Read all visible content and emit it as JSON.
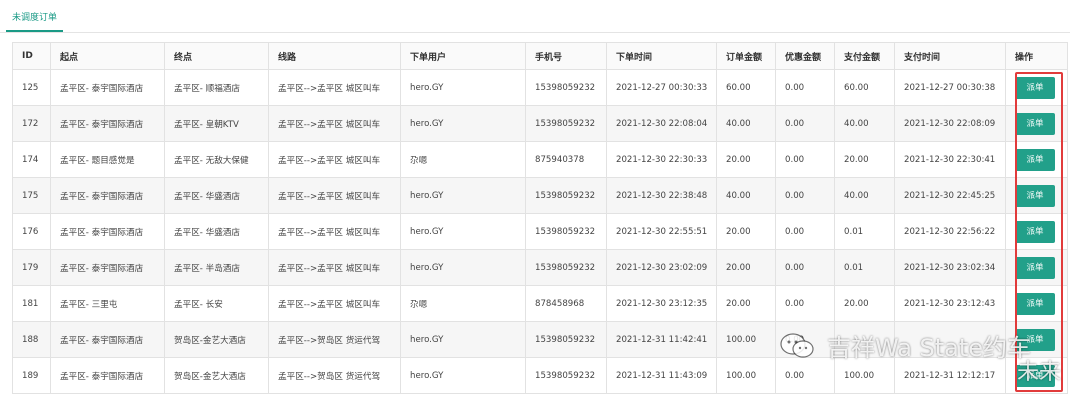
{
  "tabs": [
    {
      "label": "未调度订单"
    }
  ],
  "table": {
    "columns": [
      "ID",
      "起点",
      "终点",
      "线路",
      "下单用户",
      "手机号",
      "下单时间",
      "订单金额",
      "优惠金额",
      "支付金额",
      "支付时间",
      "操作"
    ],
    "rows": [
      {
        "id": "125",
        "start": "孟平区- 泰宇国际酒店",
        "end": "孟平区- 顺福酒店",
        "route": "孟平区-->孟平区 城区叫车",
        "user": "hero.GY",
        "phone": "15398059232",
        "order_time": "2021-12-27 00:30:33",
        "amount": "60.00",
        "discount": "0.00",
        "paid": "60.00",
        "pay_time": "2021-12-27 00:30:38",
        "action": "派单"
      },
      {
        "id": "172",
        "start": "孟平区- 泰宇国际酒店",
        "end": "孟平区- 皇朝KTV",
        "route": "孟平区-->孟平区 城区叫车",
        "user": "hero.GY",
        "phone": "15398059232",
        "order_time": "2021-12-30 22:08:04",
        "amount": "40.00",
        "discount": "0.00",
        "paid": "40.00",
        "pay_time": "2021-12-30 22:08:09",
        "action": "派单"
      },
      {
        "id": "174",
        "start": "孟平区- 题目感觉是",
        "end": "孟平区- 无敌大保健",
        "route": "孟平区-->孟平区 城区叫车",
        "user": "尕嗯",
        "phone": "875940378",
        "order_time": "2021-12-30 22:30:33",
        "amount": "20.00",
        "discount": "0.00",
        "paid": "20.00",
        "pay_time": "2021-12-30 22:30:41",
        "action": "派单"
      },
      {
        "id": "175",
        "start": "孟平区- 泰宇国际酒店",
        "end": "孟平区- 华盛酒店",
        "route": "孟平区-->孟平区 城区叫车",
        "user": "hero.GY",
        "phone": "15398059232",
        "order_time": "2021-12-30 22:38:48",
        "amount": "40.00",
        "discount": "0.00",
        "paid": "40.00",
        "pay_time": "2021-12-30 22:45:25",
        "action": "派单"
      },
      {
        "id": "176",
        "start": "孟平区- 泰宇国际酒店",
        "end": "孟平区- 华盛酒店",
        "route": "孟平区-->孟平区 城区叫车",
        "user": "hero.GY",
        "phone": "15398059232",
        "order_time": "2021-12-30 22:55:51",
        "amount": "20.00",
        "discount": "0.00",
        "paid": "0.01",
        "pay_time": "2021-12-30 22:56:22",
        "action": "派单"
      },
      {
        "id": "179",
        "start": "孟平区- 泰宇国际酒店",
        "end": "孟平区- 半岛酒店",
        "route": "孟平区-->孟平区 城区叫车",
        "user": "hero.GY",
        "phone": "15398059232",
        "order_time": "2021-12-30 23:02:09",
        "amount": "20.00",
        "discount": "0.00",
        "paid": "0.01",
        "pay_time": "2021-12-30 23:02:34",
        "action": "派单"
      },
      {
        "id": "181",
        "start": "孟平区- 三里屯",
        "end": "孟平区- 长安",
        "route": "孟平区-->孟平区 城区叫车",
        "user": "尕嗯",
        "phone": "878458968",
        "order_time": "2021-12-30 23:12:35",
        "amount": "20.00",
        "discount": "0.00",
        "paid": "20.00",
        "pay_time": "2021-12-30 23:12:43",
        "action": "派单"
      },
      {
        "id": "188",
        "start": "孟平区- 泰宇国际酒店",
        "end": "贺岛区-金艺大酒店",
        "route": "孟平区-->贺岛区 货运代驾",
        "user": "hero.GY",
        "phone": "15398059232",
        "order_time": "2021-12-31 11:42:41",
        "amount": "100.00",
        "discount": "0.00",
        "paid": "",
        "pay_time": "",
        "action": "派单"
      },
      {
        "id": "189",
        "start": "孟平区- 泰宇国际酒店",
        "end": "贺岛区-金艺大酒店",
        "route": "孟平区-->贺岛区 货运代驾",
        "user": "hero.GY",
        "phone": "15398059232",
        "order_time": "2021-12-31 11:43:09",
        "amount": "100.00",
        "discount": "0.00",
        "paid": "100.00",
        "pay_time": "2021-12-31 12:12:17",
        "action": "派单"
      }
    ]
  },
  "watermark": {
    "line1": "吉祥Wa State约车",
    "line2": "未来"
  },
  "colors": {
    "accent": "#22a08a",
    "highlight": "#e13b3b"
  }
}
